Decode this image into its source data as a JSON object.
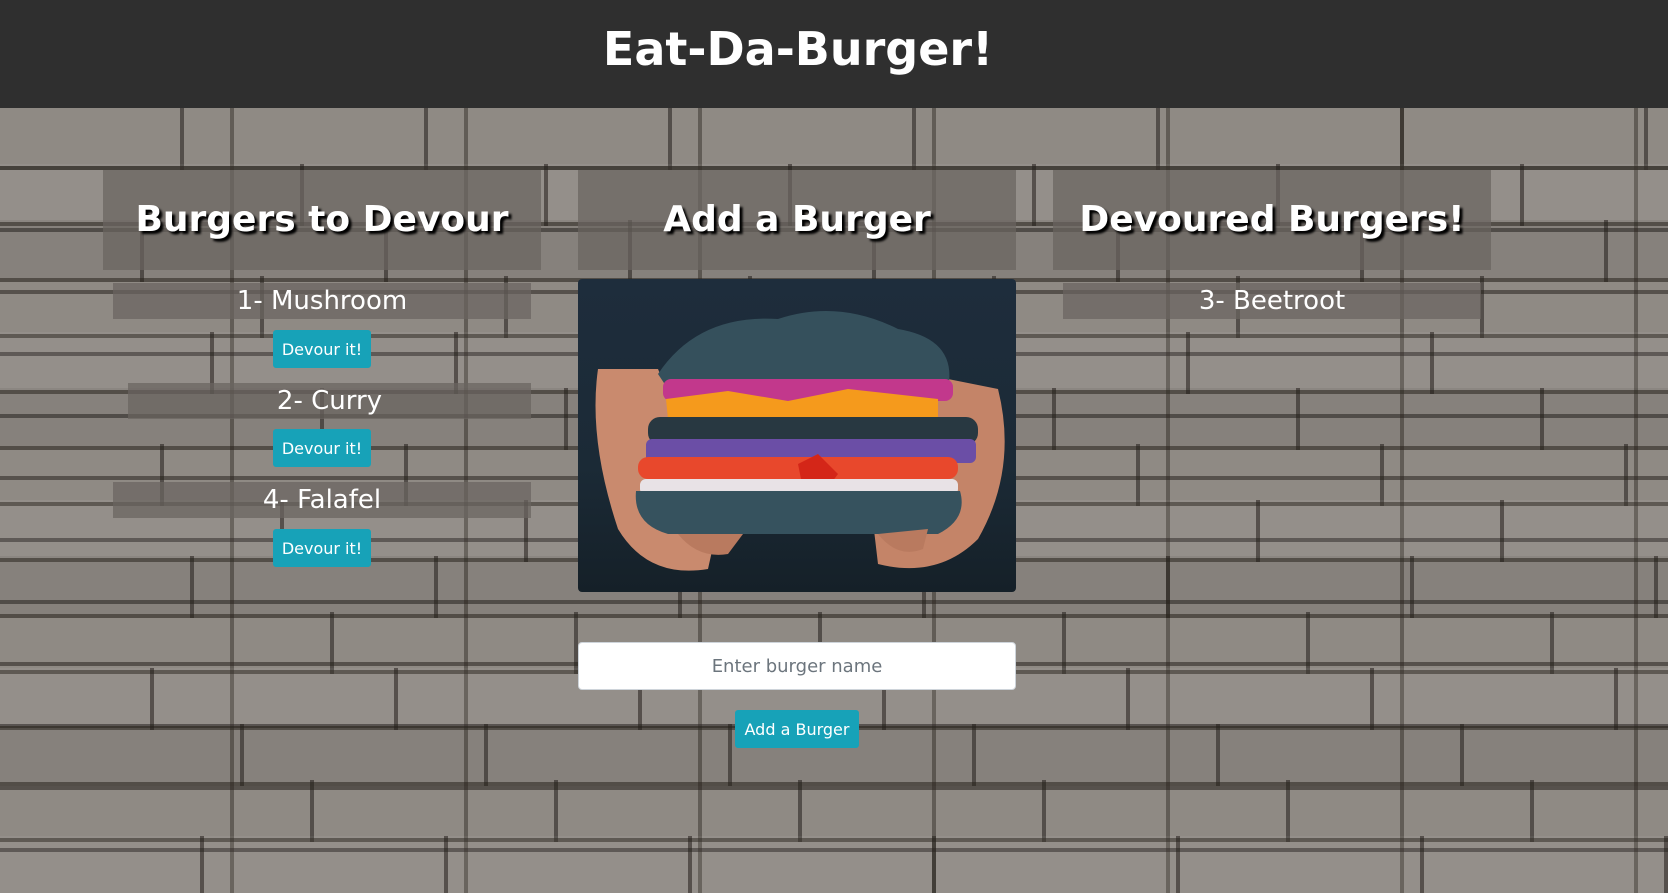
{
  "header": {
    "title": "Eat-Da-Burger!"
  },
  "to_devour": {
    "title": "Burgers to Devour",
    "items": [
      {
        "label": "1- Mushroom",
        "button": "Devour it!"
      },
      {
        "label": "2- Curry",
        "button": "Devour it!"
      },
      {
        "label": "4- Falafel",
        "button": "Devour it!"
      }
    ]
  },
  "add_burger": {
    "title": "Add a Burger",
    "input_placeholder": "Enter burger name",
    "input_value": "",
    "button": "Add a Burger"
  },
  "devoured": {
    "title": "Devoured Burgers!",
    "items": [
      {
        "label": "3- Beetroot"
      }
    ]
  },
  "colors": {
    "header_bg": "#2f2f2f",
    "button_accent": "#17a2b8",
    "panel_overlay": "rgba(105,100,96,0.72)"
  }
}
